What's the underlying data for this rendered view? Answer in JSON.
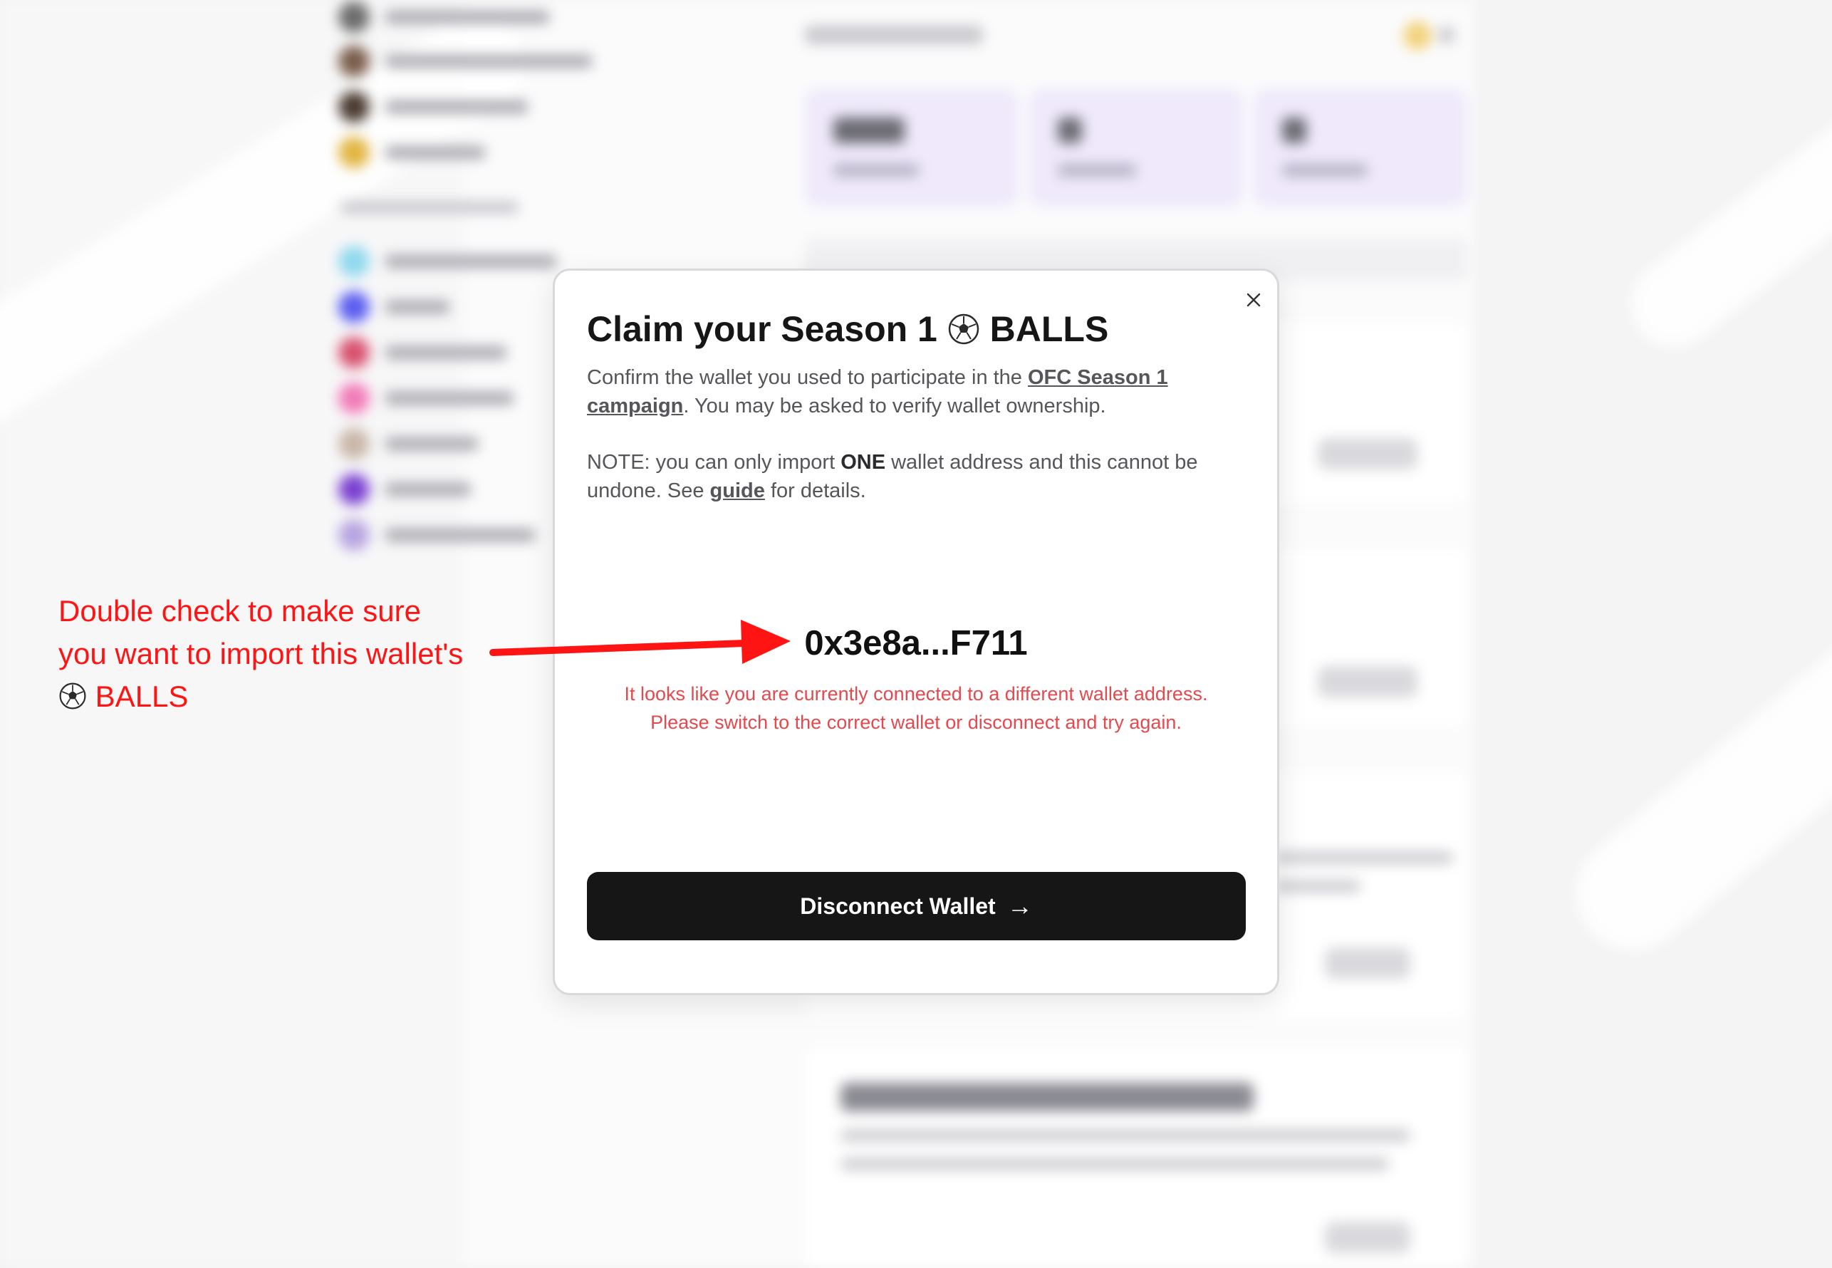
{
  "modal": {
    "title_prefix": "Claim your Season 1",
    "title_suffix": "BALLS",
    "intro_before_link": "Confirm the wallet you used to participate in the ",
    "intro_link": "OFC Season 1 campaign",
    "intro_after_link": ". You may be asked to verify wallet ownership.",
    "note_prefix": "NOTE: you can only import ",
    "note_bold": "ONE",
    "note_middle": " wallet address and this cannot be undone. See ",
    "note_link": "guide",
    "note_suffix": " for details.",
    "wallet_address": "0x3e8a...F711",
    "warning_line1": "It looks like you are currently connected to a different wallet address.",
    "warning_line2": "Please switch to the correct wallet or disconnect and try again.",
    "button_label": "Disconnect Wallet",
    "button_arrow": "→",
    "close_icon": "close-icon",
    "ball_icon": "soccer-ball-icon"
  },
  "annotation": {
    "line1": "Double check to make sure",
    "line2": "you want to import this wallet's",
    "line3_suffix": "BALLS",
    "color": "#ff1414"
  },
  "colors": {
    "primary_button": "#161616",
    "warning_text": "#e5484d",
    "stat_card": "#efe9fb"
  }
}
